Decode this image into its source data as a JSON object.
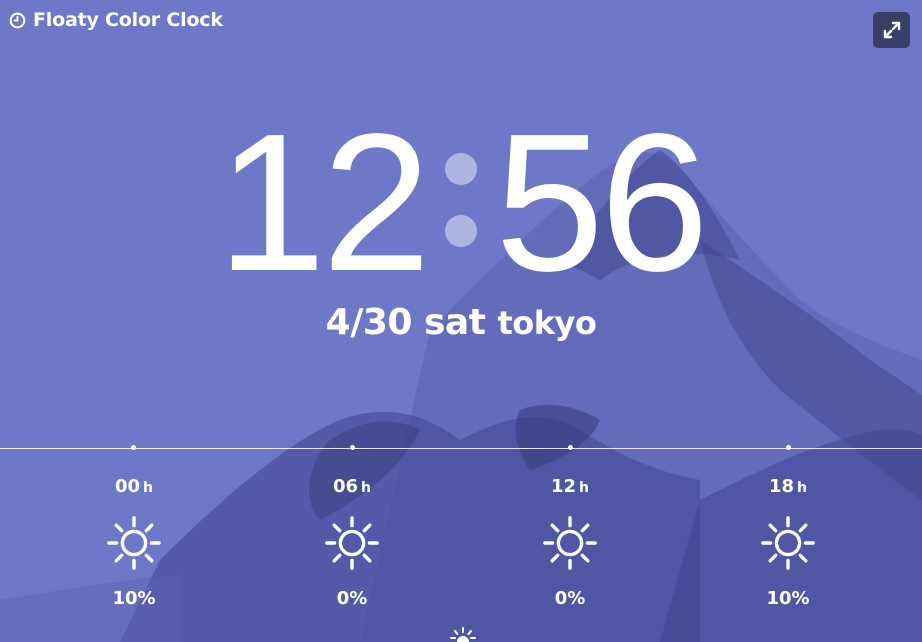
{
  "app": {
    "title": "Floaty Color Clock",
    "title_icon": "clock-icon",
    "fullscreen_icon": "expand-icon"
  },
  "clock": {
    "hours": "12",
    "minutes": "56"
  },
  "date": {
    "date_text": "4/30 sat",
    "city": "tokyo"
  },
  "forecast": [
    {
      "hour": "00",
      "unit": "h",
      "icon": "sun-icon",
      "precip": "10%"
    },
    {
      "hour": "06",
      "unit": "h",
      "icon": "sun-icon",
      "precip": "0%"
    },
    {
      "hour": "12",
      "unit": "h",
      "icon": "sun-icon",
      "precip": "0%"
    },
    {
      "hour": "18",
      "unit": "h",
      "icon": "sun-icon",
      "precip": "10%"
    }
  ],
  "colors": {
    "background": "#6d78c8",
    "mountain_dark": "#3d4284",
    "button": "#3a3f67",
    "text": "#ffffff"
  }
}
